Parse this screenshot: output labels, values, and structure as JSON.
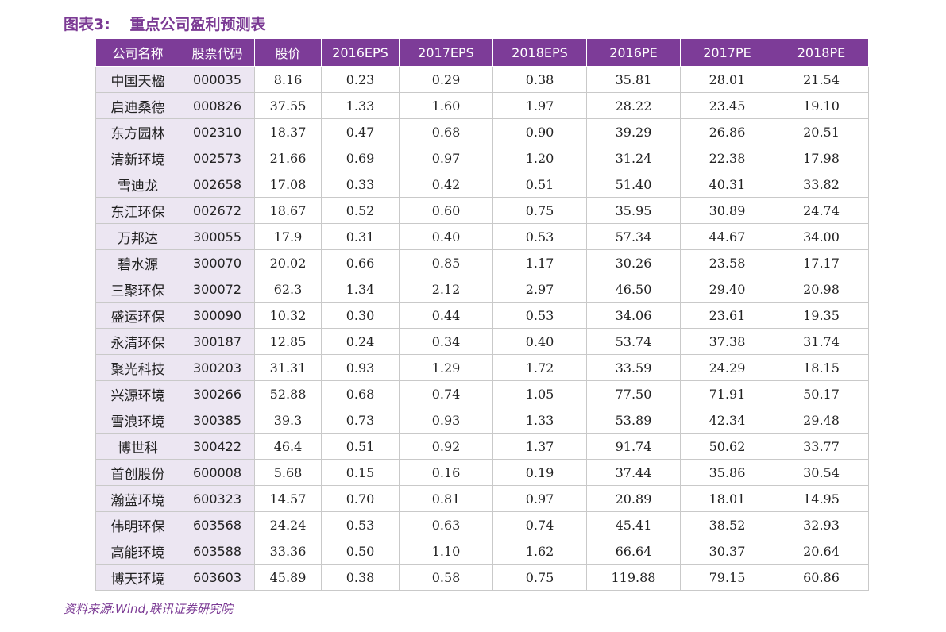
{
  "title": {
    "number": "图表3:",
    "text": "重点公司盈利预测表"
  },
  "table": {
    "headers": [
      "公司名称",
      "股票代码",
      "股价",
      "2016EPS",
      "2017EPS",
      "2018EPS",
      "2016PE",
      "2017PE",
      "2018PE"
    ],
    "rows": [
      [
        "中国天楹",
        "000035",
        "8.16",
        "0.23",
        "0.29",
        "0.38",
        "35.81",
        "28.01",
        "21.54"
      ],
      [
        "启迪桑德",
        "000826",
        "37.55",
        "1.33",
        "1.60",
        "1.97",
        "28.22",
        "23.45",
        "19.10"
      ],
      [
        "东方园林",
        "002310",
        "18.37",
        "0.47",
        "0.68",
        "0.90",
        "39.29",
        "26.86",
        "20.51"
      ],
      [
        "清新环境",
        "002573",
        "21.66",
        "0.69",
        "0.97",
        "1.20",
        "31.24",
        "22.38",
        "17.98"
      ],
      [
        "雪迪龙",
        "002658",
        "17.08",
        "0.33",
        "0.42",
        "0.51",
        "51.40",
        "40.31",
        "33.82"
      ],
      [
        "东江环保",
        "002672",
        "18.67",
        "0.52",
        "0.60",
        "0.75",
        "35.95",
        "30.89",
        "24.74"
      ],
      [
        "万邦达",
        "300055",
        "17.9",
        "0.31",
        "0.40",
        "0.53",
        "57.34",
        "44.67",
        "34.00"
      ],
      [
        "碧水源",
        "300070",
        "20.02",
        "0.66",
        "0.85",
        "1.17",
        "30.26",
        "23.58",
        "17.17"
      ],
      [
        "三聚环保",
        "300072",
        "62.3",
        "1.34",
        "2.12",
        "2.97",
        "46.50",
        "29.40",
        "20.98"
      ],
      [
        "盛运环保",
        "300090",
        "10.32",
        "0.30",
        "0.44",
        "0.53",
        "34.06",
        "23.61",
        "19.35"
      ],
      [
        "永清环保",
        "300187",
        "12.85",
        "0.24",
        "0.34",
        "0.40",
        "53.74",
        "37.38",
        "31.74"
      ],
      [
        "聚光科技",
        "300203",
        "31.31",
        "0.93",
        "1.29",
        "1.72",
        "33.59",
        "24.29",
        "18.15"
      ],
      [
        "兴源环境",
        "300266",
        "52.88",
        "0.68",
        "0.74",
        "1.05",
        "77.50",
        "71.91",
        "50.17"
      ],
      [
        "雪浪环境",
        "300385",
        "39.3",
        "0.73",
        "0.93",
        "1.33",
        "53.89",
        "42.34",
        "29.48"
      ],
      [
        "博世科",
        "300422",
        "46.4",
        "0.51",
        "0.92",
        "1.37",
        "91.74",
        "50.62",
        "33.77"
      ],
      [
        "首创股份",
        "600008",
        "5.68",
        "0.15",
        "0.16",
        "0.19",
        "37.44",
        "35.86",
        "30.54"
      ],
      [
        "瀚蓝环境",
        "600323",
        "14.57",
        "0.70",
        "0.81",
        "0.97",
        "20.89",
        "18.01",
        "14.95"
      ],
      [
        "伟明环保",
        "603568",
        "24.24",
        "0.53",
        "0.63",
        "0.74",
        "45.41",
        "38.52",
        "32.93"
      ],
      [
        "高能环境",
        "603588",
        "33.36",
        "0.50",
        "1.10",
        "1.62",
        "66.64",
        "30.37",
        "20.64"
      ],
      [
        "博天环境",
        "603603",
        "45.89",
        "0.38",
        "0.58",
        "0.75",
        "119.88",
        "79.15",
        "60.86"
      ]
    ]
  },
  "source": "资料来源:Wind,联讯证券研究院",
  "colors": {
    "accent": "#7d3c98",
    "title": "#7b3a94",
    "shade": "#ece6f2"
  }
}
